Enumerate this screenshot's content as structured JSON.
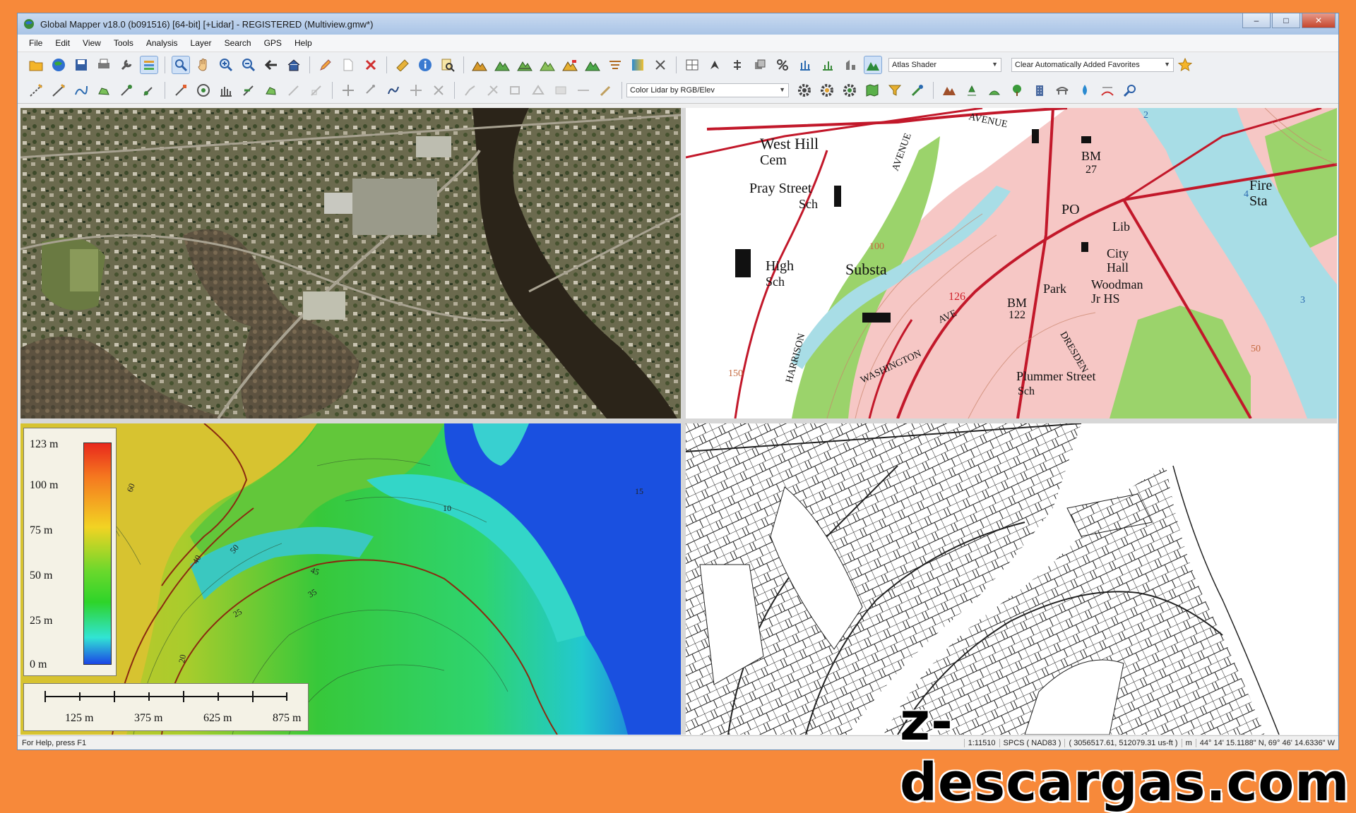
{
  "window": {
    "title": "Global Mapper v18.0 (b091516) [64-bit] [+Lidar] - REGISTERED (Multiview.gmw*)",
    "buttons": [
      "–",
      "□",
      "✕"
    ]
  },
  "menu": [
    "File",
    "Edit",
    "View",
    "Tools",
    "Analysis",
    "Layer",
    "Search",
    "GPS",
    "Help"
  ],
  "toolbar1": {
    "shader_select": "Atlas Shader",
    "favorites_select": "Clear Automatically Added Favorites"
  },
  "toolbar2": {
    "lidar_color_select": "Color Lidar by RGB/Elev"
  },
  "topo_map": {
    "labels": [
      "West Hill",
      "Cem",
      "Pray Street",
      "Sch",
      "High",
      "Sch",
      "Substa",
      "Park",
      "BM",
      "122",
      "Woodman",
      "Jr HS",
      "City",
      "Hall",
      "Lib",
      "PO",
      "BM",
      "27",
      "Fire",
      "Sta",
      "Plummer Street",
      "Sch",
      "AVENUE",
      "AVENUE",
      "HARRISON",
      "WASHINGTON",
      "AVE",
      "DRESDEN",
      "126",
      "150",
      "100",
      "50",
      "2",
      "3",
      "4"
    ]
  },
  "elevation": {
    "legend": [
      "123 m",
      "100 m",
      "75 m",
      "50 m",
      "25 m",
      "0 m"
    ],
    "scale": [
      "125 m",
      "375 m",
      "625 m",
      "875 m"
    ],
    "contour_labels": [
      "60",
      "50",
      "40",
      "10",
      "45",
      "35",
      "25",
      "20",
      "15"
    ]
  },
  "status": {
    "help": "For Help, press F1",
    "scale": "1:11510",
    "projection": "SPCS ( NAD83 )",
    "coords": "( 3056517.61, 512079.31 us-ft )",
    "elev": "m",
    "latlon": "44° 14' 15.1188\" N, 69° 46' 14.6336\" W"
  },
  "watermark": "z-descargas.com",
  "colors": {
    "frame": "#f7893a",
    "titlebar": "#b5cdeb",
    "topo_pink": "#f6c7c5",
    "topo_green": "#9bd36b",
    "river_topo": "#a8dde6",
    "road_red": "#c2182a"
  }
}
